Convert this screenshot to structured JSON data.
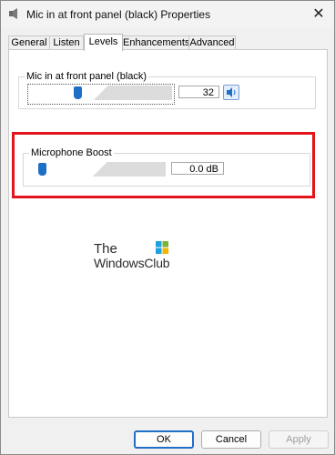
{
  "window": {
    "title": "Mic in at front panel (black) Properties",
    "close_glyph": "✕"
  },
  "tabs": [
    {
      "label": "General"
    },
    {
      "label": "Listen"
    },
    {
      "label": "Levels"
    },
    {
      "label": "Enhancements"
    },
    {
      "label": "Advanced"
    }
  ],
  "active_tab": "Levels",
  "mic_level": {
    "group_label": "Mic in at front panel (black)",
    "value": "32",
    "slider_fraction": 0.32,
    "mute_icon": "speaker-icon"
  },
  "boost": {
    "group_label": "Microphone Boost",
    "value": "0.0 dB",
    "slider_fraction": 0.0
  },
  "watermark": {
    "line1": "The",
    "line2": "WindowsClub"
  },
  "buttons": {
    "ok": "OK",
    "cancel": "Cancel",
    "apply": "Apply"
  },
  "colors": {
    "accent": "#1f6fc6",
    "highlight": "#e3141b"
  }
}
